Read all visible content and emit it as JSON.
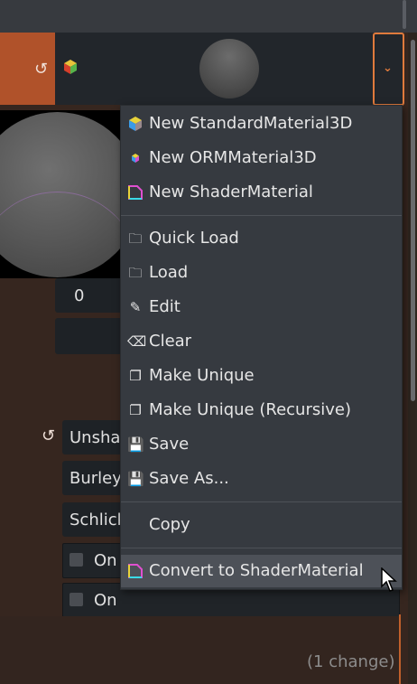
{
  "preview_field": {
    "value": "0"
  },
  "options": [
    "Unshaded",
    "Burley",
    "Schlick"
  ],
  "checkboxes": [
    {
      "label": "On",
      "checked": false
    },
    {
      "label": "On",
      "checked": false
    }
  ],
  "status": {
    "changes": "(1 change)"
  },
  "menu": {
    "items": [
      {
        "label": "New StandardMaterial3D",
        "icon": "standard-material-icon"
      },
      {
        "label": "New ORMMaterial3D",
        "icon": "orm-material-icon"
      },
      {
        "label": "New ShaderMaterial",
        "icon": "shader-material-icon"
      },
      {
        "label": "Quick Load",
        "icon": "folder-icon"
      },
      {
        "label": "Load",
        "icon": "folder-icon"
      },
      {
        "label": "Edit",
        "icon": "edit-icon"
      },
      {
        "label": "Clear",
        "icon": "clear-icon"
      },
      {
        "label": "Make Unique",
        "icon": "duplicate-icon"
      },
      {
        "label": "Make Unique (Recursive)",
        "icon": "duplicate-icon"
      },
      {
        "label": "Save",
        "icon": "save-icon"
      },
      {
        "label": "Save As...",
        "icon": "save-icon"
      },
      {
        "label": "Copy",
        "icon": ""
      },
      {
        "label": "Convert to ShaderMaterial",
        "icon": "shader-material-icon"
      }
    ]
  },
  "colors": {
    "accent": "#b0522a",
    "focus_border": "#e07a3c",
    "menu_bg": "#363a40",
    "highlight": "#4d5158"
  }
}
